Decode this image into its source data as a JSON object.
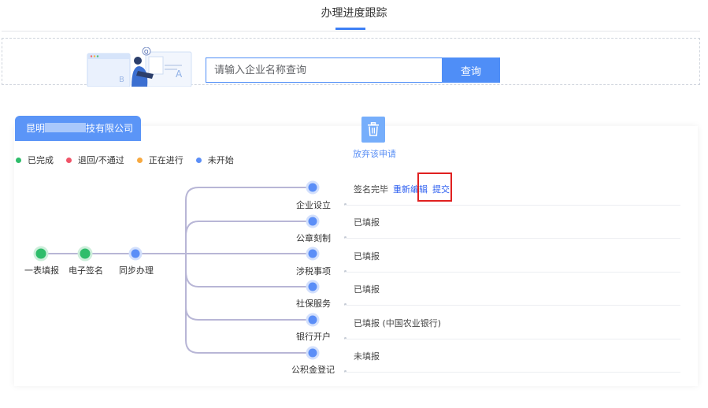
{
  "header": {
    "title": "办理进度跟踪"
  },
  "search": {
    "placeholder": "请输入企业名称查询",
    "button_label": "查询"
  },
  "company": {
    "name_prefix": "昆明",
    "name_suffix": "技有限公司"
  },
  "legend": [
    {
      "label": "已完成",
      "color": "#2fbd6b"
    },
    {
      "label": "退回/不通过",
      "color": "#f05468"
    },
    {
      "label": "正在进行",
      "color": "#f7a940"
    },
    {
      "label": "未开始",
      "color": "#5b8ef7"
    }
  ],
  "actions": {
    "abandon_label": "放弃该申请"
  },
  "flow": {
    "main_steps": [
      {
        "label": "一表填报",
        "state": "completed"
      },
      {
        "label": "电子签名",
        "state": "completed"
      },
      {
        "label": "同步办理",
        "state": "not_started"
      }
    ],
    "branches": [
      {
        "label": "企业设立",
        "status": "签名完毕",
        "links": [
          "重新编辑",
          "提交"
        ]
      },
      {
        "label": "公章刻制",
        "status": "已填报",
        "links": []
      },
      {
        "label": "涉税事项",
        "status": "已填报",
        "links": []
      },
      {
        "label": "社保服务",
        "status": "已填报",
        "links": []
      },
      {
        "label": "银行开户",
        "status": "已填报 (中国农业银行)",
        "links": []
      },
      {
        "label": "公积金登记",
        "status": "未填报",
        "links": []
      }
    ]
  },
  "colors": {
    "accent": "#4f8ef7",
    "completed": "#2fbd6b",
    "not_started": "#5b8ef7",
    "connector": "#b8b6d6",
    "highlight": "#e02020"
  }
}
